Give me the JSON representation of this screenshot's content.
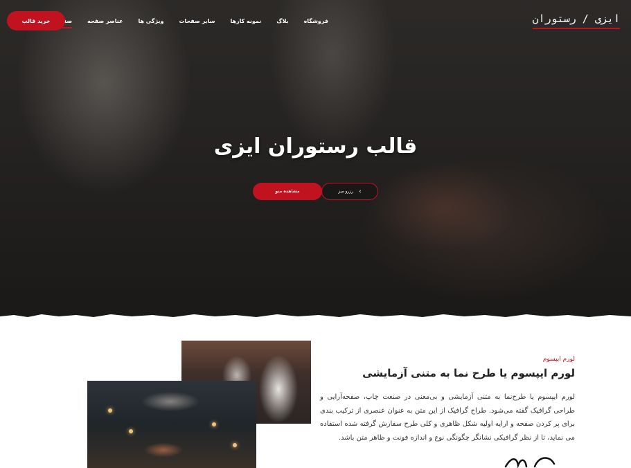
{
  "header": {
    "logo": "ایزی / رستوران",
    "buy_button": "خرید قالب",
    "nav": [
      {
        "label": "صفحه اصلی",
        "active": true
      },
      {
        "label": "عناصر صفحه",
        "active": false
      },
      {
        "label": "ویژگی ها",
        "active": false
      },
      {
        "label": "سایر صفحات",
        "active": false
      },
      {
        "label": "نمونه کارها",
        "active": false
      },
      {
        "label": "بلاگ",
        "active": false
      },
      {
        "label": "فروشگاه",
        "active": false
      }
    ]
  },
  "hero": {
    "title": "قالب رستوران ایزی",
    "btn_menu": "مشاهده منو",
    "btn_reserve": "رزرو میز"
  },
  "about": {
    "eyebrow": "لورم ایپسوم",
    "heading": "لورم ایپسوم یا طرح نما به متنی آزمایشی",
    "text": "لورم ایپسوم یا طرح‌نما به متنی آزمایشی و بی‌معنی در صنعت چاپ، صفحه‌آرایی و طراحی گرافیک گفته می‌شود. طراح گرافیک از این متن به عنوان عنصری از ترکیب بندی برای پر کردن صفحه و ارایه اولیه شکل ظاهری و کلی طرح سفارش گرفته شده استفاده می نماید، تا از نظر گرافیکی نشانگر چگونگی نوع و اندازه فونت و ظاهر متن باشد."
  },
  "colors": {
    "accent": "#c1121f",
    "text_dark": "#222222",
    "body_text": "#333333"
  },
  "icons": {
    "reserve_button": "chevron-right-icon"
  }
}
